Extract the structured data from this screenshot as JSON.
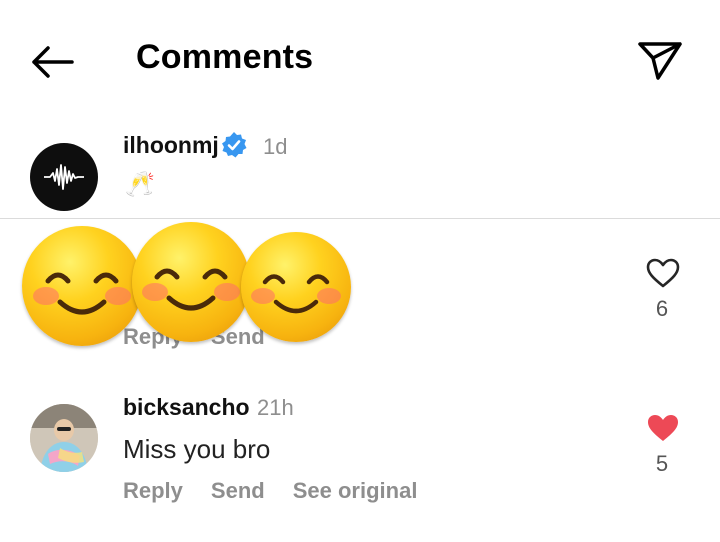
{
  "header": {
    "title": "Comments",
    "back_icon": "arrow-left-icon",
    "share_icon": "paper-plane-icon"
  },
  "caption": {
    "username": "ilhoonmj",
    "verified": true,
    "time": "1d",
    "text": "🥂",
    "avatar_icon": "sound-wave-logo"
  },
  "comments": [
    {
      "username": "",
      "actions": [
        "Reply",
        "Send"
      ],
      "like_count": "6",
      "liked": false,
      "covered_by_stickers": true
    },
    {
      "username": "bicksancho",
      "time": "21h",
      "text": "Miss you bro",
      "actions": [
        "Reply",
        "Send",
        "See original"
      ],
      "like_count": "5",
      "liked": true
    }
  ],
  "stickers": [
    "smiling-face-emoji",
    "smiling-face-emoji",
    "smiling-face-emoji"
  ],
  "colors": {
    "liked_heart": "#ed4956",
    "verified_badge": "#3897f0",
    "secondary_text": "#8e8e8e",
    "divider": "#dbdbdb"
  }
}
